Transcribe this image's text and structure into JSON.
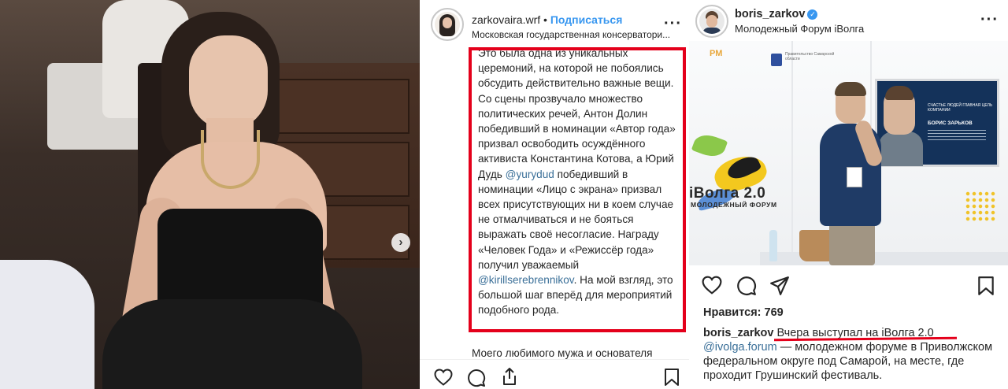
{
  "post_left": {
    "username": "zarkovaira.wrf",
    "separator": " • ",
    "follow_label": "Подписаться",
    "location": "Московская государственная консерватори...",
    "caption_parts": [
      {
        "text": "Это была одна из уникальных церемоний, на которой не побоялись обсудить действительно важные вещи. Со сцены прозвучало множество политических речей, Антон Долин победивший в номинации «Автор года» призвал освободить осуждённого активиста Константина Котова, а Юрий Дудь ",
        "type": "text"
      },
      {
        "text": "@yurydud",
        "type": "mention"
      },
      {
        "text": " победивший в номинации «Лицо с экрана» призвал всех присутствующих ни в коем случае не отмалчиваться и не бояться выражать своё несогласие. Награду «Человек Года» и «Режиссёр года» получил уважаемый ",
        "type": "text"
      },
      {
        "text": "@kirillserebrennikov",
        "type": "mention"
      },
      {
        "text": ". На мой взгляд, это большой шаг вперёд для мероприятий подобного рода.",
        "type": "text"
      }
    ],
    "more_text": "Моего любимого мужа и основателя",
    "icons": [
      "heart-icon",
      "comment-icon",
      "share-icon",
      "bookmark-icon"
    ]
  },
  "photo": {
    "next_button": "›"
  },
  "post_right": {
    "username": "boris_zarkov",
    "verified_mark": "✓",
    "location": "Молодежный Форум iВолга",
    "image_text": {
      "rm": "РМ",
      "logo_text": "Правительство Самарской области",
      "brand": "iВолга 2.0",
      "brand_sub": "МОЛОДЕЖНЫЙ ФОРУМ",
      "screen_title": "СЧАСТЬЕ ЛЮДЕЙ ГЛАВНАЯ ЦЕЛЬ КОМПАНИИ",
      "screen_name": "БОРИС ЗАРЬКОВ"
    },
    "likes": "Нравится: 769",
    "caption_user": "boris_zarkov",
    "caption_lead": " Вчера выступал на iВолга 2.0",
    "caption_mention": "@ivolga.forum",
    "caption_rest": " — молодежном форуме в Приволжском федеральном округе под Самарой, на месте, где проходит Грушинский фестиваль.",
    "icons": [
      "heart-icon",
      "comment-icon",
      "share-icon",
      "bookmark-icon"
    ]
  },
  "colors": {
    "accent_blue": "#3897f0",
    "mention": "#3a6f98",
    "highlight_red": "#e4001b"
  }
}
